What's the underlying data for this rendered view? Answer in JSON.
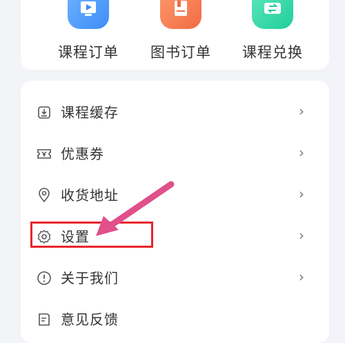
{
  "quick_actions": [
    {
      "label": "课程订单",
      "icon": "course-order-icon",
      "color": "#3d8ef7"
    },
    {
      "label": "图书订单",
      "icon": "book-order-icon",
      "color": "#f26b43"
    },
    {
      "label": "课程兑换",
      "icon": "exchange-icon",
      "color": "#1fcf9b"
    }
  ],
  "menu": {
    "items": [
      {
        "label": "课程缓存",
        "icon": "download-icon"
      },
      {
        "label": "优惠券",
        "icon": "coupon-icon"
      },
      {
        "label": "收货地址",
        "icon": "location-pin-icon"
      },
      {
        "label": "设置",
        "icon": "gear-icon"
      },
      {
        "label": "关于我们",
        "icon": "info-circle-icon"
      },
      {
        "label": "意见反馈",
        "icon": "feedback-icon"
      }
    ],
    "chevron": "›"
  },
  "annotation": {
    "highlight_color": "#e8242c",
    "arrow_color": "#e0508a"
  }
}
